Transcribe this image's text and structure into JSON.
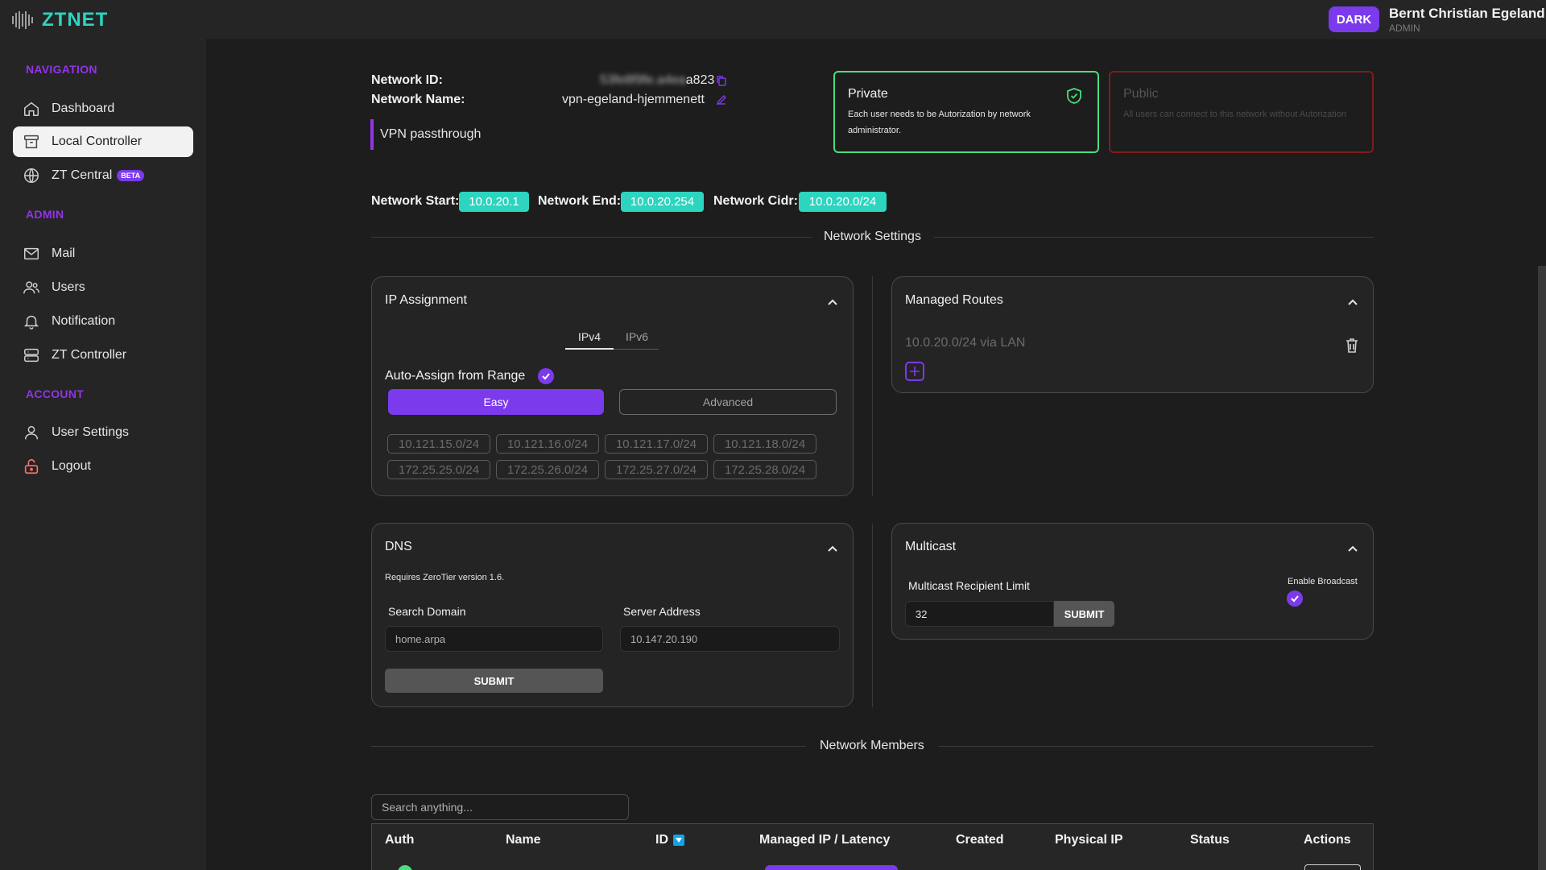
{
  "app": {
    "logo_text": "ZTNET"
  },
  "topbar": {
    "theme_button": "DARK",
    "user_name": "Bernt Christian Egeland",
    "user_role": "ADMIN"
  },
  "sidebar": {
    "sections": [
      {
        "title": "NAVIGATION",
        "items": [
          {
            "label": "Dashboard",
            "icon": "home-icon"
          },
          {
            "label": "Local Controller",
            "icon": "archive-icon",
            "active": true
          },
          {
            "label": "ZT Central",
            "icon": "globe-icon",
            "badge": "BETA"
          }
        ]
      },
      {
        "title": "ADMIN",
        "items": [
          {
            "label": "Mail",
            "icon": "mail-icon"
          },
          {
            "label": "Users",
            "icon": "users-icon"
          },
          {
            "label": "Notification",
            "icon": "bell-icon"
          },
          {
            "label": "ZT Controller",
            "icon": "server-icon"
          }
        ]
      },
      {
        "title": "ACCOUNT",
        "items": [
          {
            "label": "User Settings",
            "icon": "user-icon"
          },
          {
            "label": "Logout",
            "icon": "lock-icon"
          }
        ]
      }
    ]
  },
  "network": {
    "id_label": "Network ID:",
    "id_blurred": "53fe8f9fe.a4ea",
    "id_suffix": "a823",
    "name_label": "Network Name:",
    "name_value": "vpn-egeland-hjemmenett",
    "description": "VPN passthrough",
    "start_label": "Network Start:",
    "start_value": "10.0.20.1",
    "end_label": "Network End:",
    "end_value": "10.0.20.254",
    "cidr_label": "Network Cidr:",
    "cidr_value": "10.0.20.0/24"
  },
  "access": {
    "private_title": "Private",
    "private_desc": "Each user needs to be Autorization by network administrator.",
    "public_title": "Public",
    "public_desc": "All users can connect to this network without Autorization"
  },
  "settings_divider": "Network Settings",
  "ip_assignment": {
    "title": "IP Assignment",
    "tabs": [
      "IPv4",
      "IPv6"
    ],
    "active_tab": "IPv4",
    "auto_assign_label": "Auto-Assign from Range",
    "auto_assign_checked": true,
    "easy_label": "Easy",
    "advanced_label": "Advanced",
    "ranges": [
      "10.121.15.0/24",
      "10.121.16.0/24",
      "10.121.17.0/24",
      "10.121.18.0/24",
      "172.25.25.0/24",
      "172.25.26.0/24",
      "172.25.27.0/24",
      "172.25.28.0/24"
    ]
  },
  "managed_routes": {
    "title": "Managed Routes",
    "routes": [
      "10.0.20.0/24 via LAN"
    ]
  },
  "dns": {
    "title": "DNS",
    "note": "Requires ZeroTier version 1.6.",
    "search_domain_label": "Search Domain",
    "search_domain_value": "home.arpa",
    "server_address_label": "Server Address",
    "server_address_value": "10.147.20.190",
    "submit_label": "SUBMIT"
  },
  "multicast": {
    "title": "Multicast",
    "limit_label": "Multicast Recipient Limit",
    "limit_value": "32",
    "submit_label": "SUBMIT",
    "broadcast_label": "Enable Broadcast",
    "broadcast_checked": true
  },
  "members_divider": "Network Members",
  "members": {
    "search_placeholder": "Search anything...",
    "columns": [
      "Auth",
      "Name",
      "ID",
      "Managed IP / Latency",
      "Created",
      "Physical IP",
      "Status",
      "Actions"
    ]
  },
  "colors": {
    "accent": "#7c3aed",
    "teal": "#2dd4bf",
    "success": "#4ade80",
    "danger": "#7f1d1d"
  }
}
